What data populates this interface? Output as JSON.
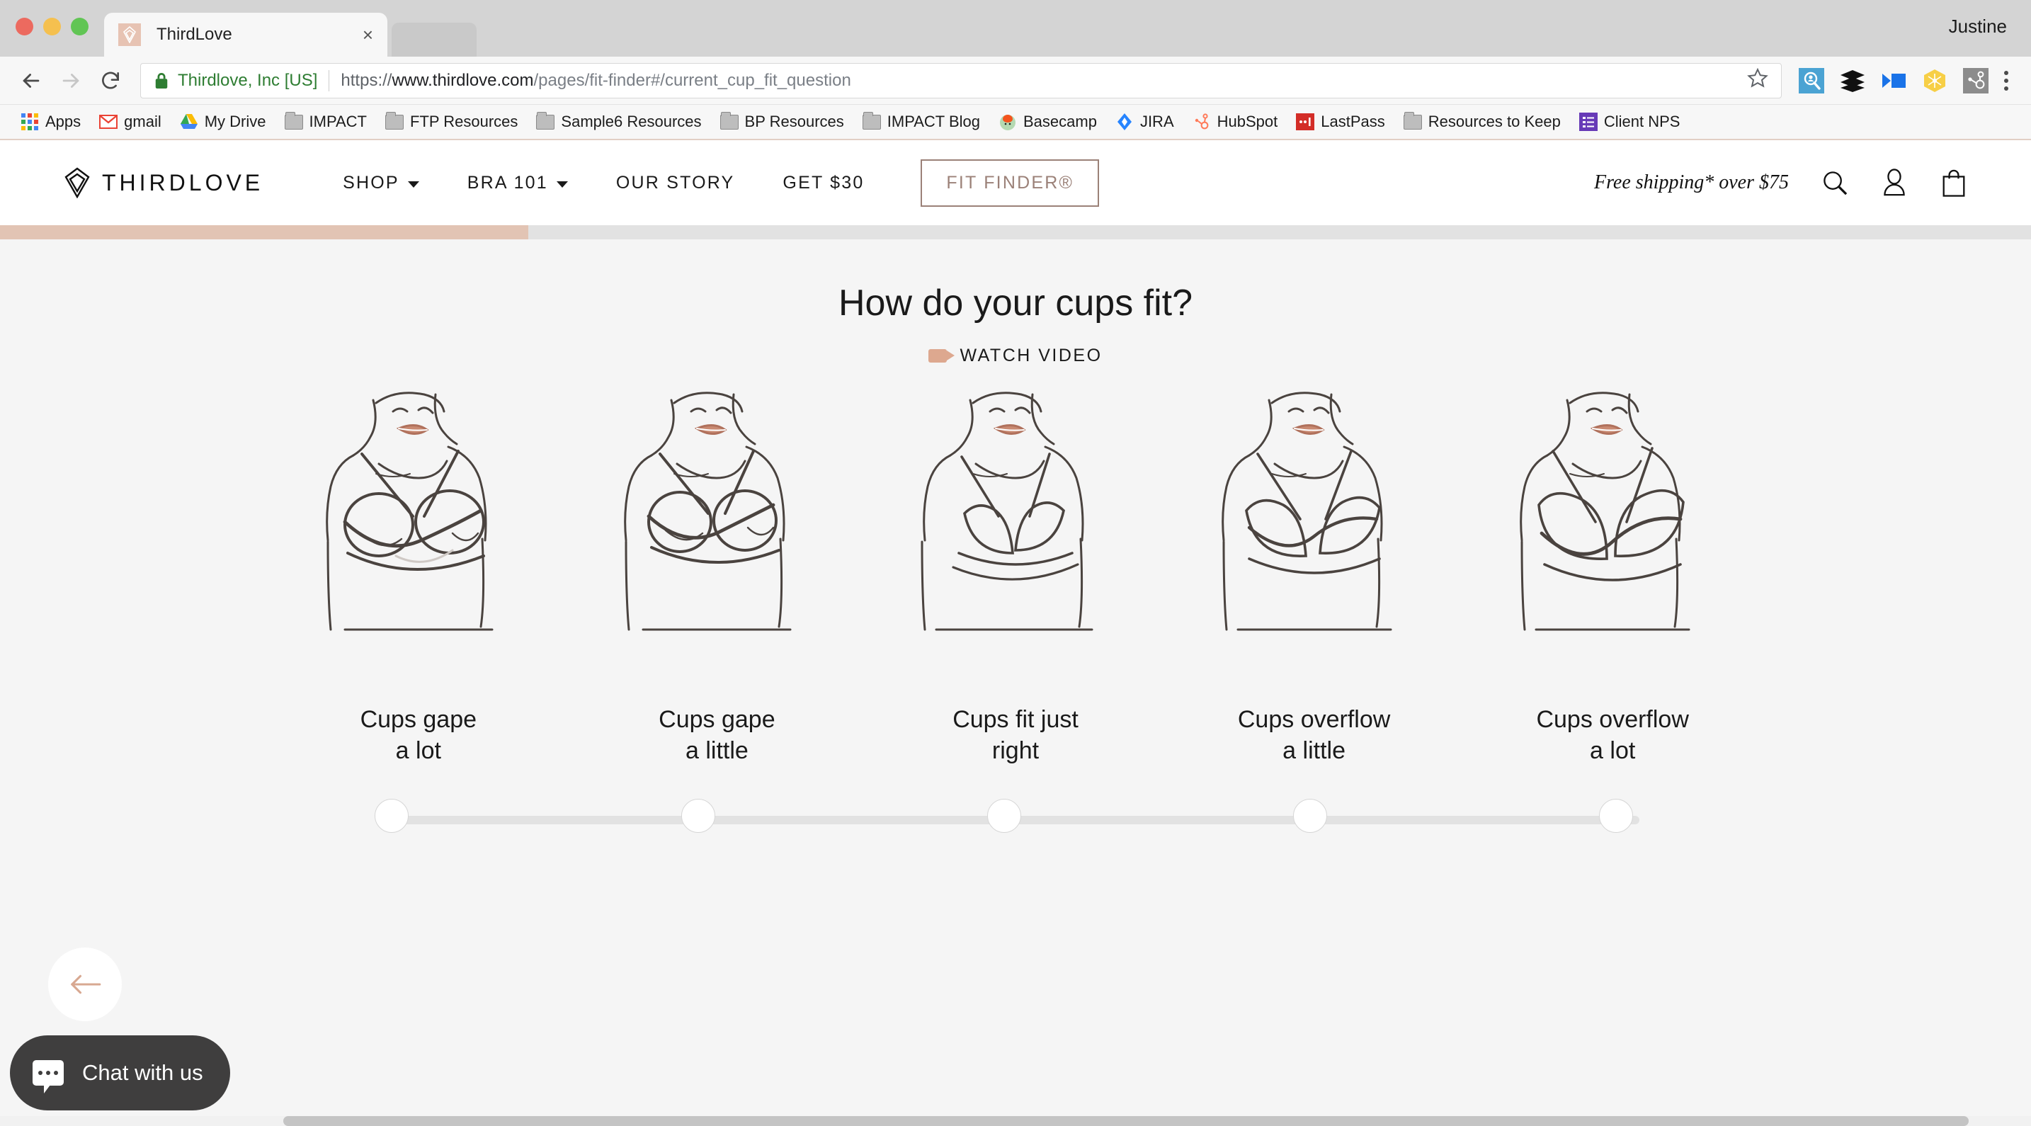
{
  "browser": {
    "tab": {
      "title": "ThirdLove",
      "favicon": "thirdlove-diamond-icon",
      "close": "×"
    },
    "profile": "Justine",
    "omnibox": {
      "security_label": "Thirdlove, Inc [US]",
      "url_scheme": "https://",
      "url_host": "www.thirdlove.com",
      "url_path": "/pages/fit-finder#/current_cup_fit_question",
      "full_url": "https://www.thirdlove.com/pages/fit-finder#/current_cup_fit_question"
    },
    "nav": {
      "back": "back-arrow",
      "forward": "forward-arrow",
      "reload": "reload-icon"
    },
    "extensions": [
      "lead-search-icon",
      "buffer-icon",
      "vidyard-icon",
      "honey-icon",
      "hubspot-icon"
    ],
    "bookmarks": [
      {
        "label": "Apps",
        "icon": "apps-grid-icon"
      },
      {
        "label": "gmail",
        "icon": "gmail-icon"
      },
      {
        "label": "My Drive",
        "icon": "google-drive-icon"
      },
      {
        "label": "IMPACT",
        "icon": "folder-icon"
      },
      {
        "label": "FTP Resources",
        "icon": "folder-icon"
      },
      {
        "label": "Sample6 Resources",
        "icon": "folder-icon"
      },
      {
        "label": "BP Resources",
        "icon": "folder-icon"
      },
      {
        "label": "IMPACT Blog",
        "icon": "folder-icon"
      },
      {
        "label": "Basecamp",
        "icon": "basecamp-icon"
      },
      {
        "label": "JIRA",
        "icon": "jira-icon"
      },
      {
        "label": "HubSpot",
        "icon": "hubspot-icon"
      },
      {
        "label": "LastPass",
        "icon": "lastpass-icon"
      },
      {
        "label": "Resources to Keep",
        "icon": "folder-icon"
      },
      {
        "label": "Client NPS",
        "icon": "google-forms-icon"
      }
    ]
  },
  "site": {
    "brand": "THIRDLOVE",
    "nav": [
      {
        "label": "SHOP",
        "has_dropdown": true
      },
      {
        "label": "BRA 101",
        "has_dropdown": true
      },
      {
        "label": "OUR STORY",
        "has_dropdown": false
      },
      {
        "label": "GET $30",
        "has_dropdown": false
      }
    ],
    "fit_finder_button": "FIT FINDER®",
    "shipping_note": "Free shipping* over $75",
    "icons": [
      "search-icon",
      "account-icon",
      "bag-icon"
    ],
    "accent_color": "#e2c4b4",
    "button_color": "#9b8178"
  },
  "quiz": {
    "progress_percent": 26,
    "question": "How do your cups fit?",
    "watch_video_label": "WATCH VIDEO",
    "options": [
      {
        "label": "Cups gape\na lot",
        "illustration": "bra-fit-gape-a-lot"
      },
      {
        "label": "Cups gape\na little",
        "illustration": "bra-fit-gape-a-little"
      },
      {
        "label": "Cups fit just\nright",
        "illustration": "bra-fit-just-right"
      },
      {
        "label": "Cups overflow\na little",
        "illustration": "bra-fit-overflow-a-little"
      },
      {
        "label": "Cups overflow\na lot",
        "illustration": "bra-fit-overflow-a-lot"
      }
    ],
    "back_button": "back-arrow-icon"
  },
  "chat": {
    "label": "Chat with us",
    "icon": "chat-bubble-icon"
  }
}
